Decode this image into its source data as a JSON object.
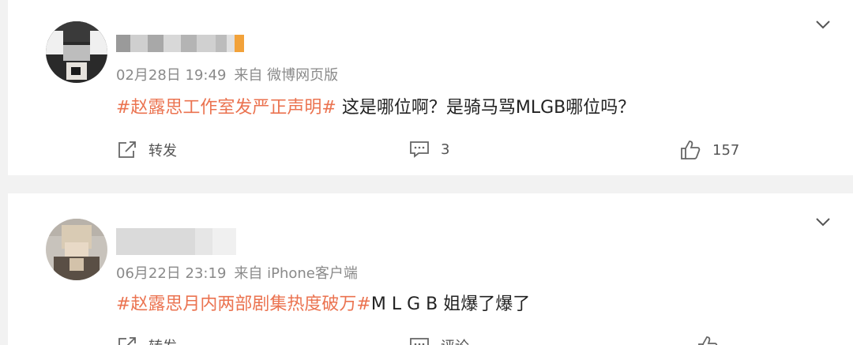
{
  "comments": [
    {
      "timestamp": "02月28日 19:49",
      "source": "来自 微博网页版",
      "topic": "#赵露思工作室发严正声明#",
      "text": " 这是哪位啊？是骑马骂MLGB哪位吗？",
      "repost_label": "转发",
      "comment_count": "3",
      "like_count": "157"
    },
    {
      "timestamp": "06月22日 23:19",
      "source": "来自 iPhone客户端",
      "topic": "#赵露思月内两部剧集热度破万#",
      "text": "M L G B 姐爆了爆了",
      "repost_label": "转发",
      "comment_label": "评论"
    }
  ],
  "colors": {
    "topic": "#eb7350",
    "meta": "#8a8a8a",
    "text": "#222222"
  },
  "icons": [
    "chevron-down-icon",
    "share-icon",
    "comment-icon",
    "like-icon"
  ]
}
